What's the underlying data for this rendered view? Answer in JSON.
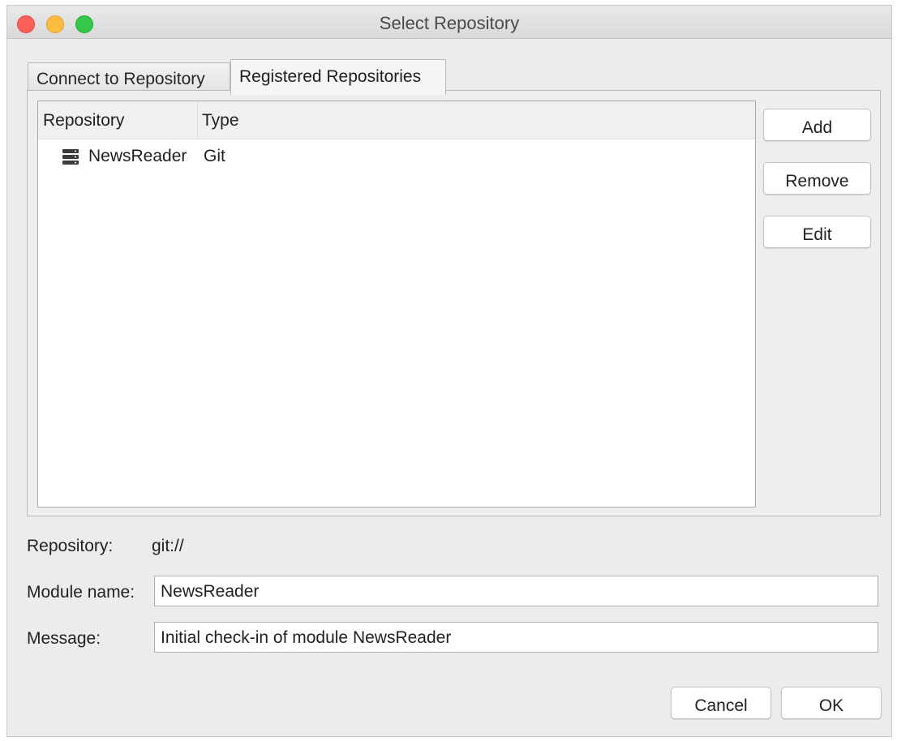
{
  "window": {
    "title": "Select Repository"
  },
  "tabs": [
    {
      "label": "Connect to Repository",
      "active": false
    },
    {
      "label": "Registered Repositories",
      "active": true
    }
  ],
  "table": {
    "columns": [
      "Repository",
      "Type"
    ],
    "rows": [
      {
        "icon": "server-icon",
        "name": "NewsReader",
        "type": "Git"
      }
    ]
  },
  "side_buttons": {
    "add": "Add",
    "remove": "Remove",
    "edit": "Edit"
  },
  "form": {
    "repository_label": "Repository:",
    "repository_value": "git://",
    "module_label": "Module name:",
    "module_value": "NewsReader",
    "message_label": "Message:",
    "message_value": "Initial check-in of module NewsReader"
  },
  "footer": {
    "cancel": "Cancel",
    "ok": "OK"
  },
  "colors": {
    "close": "#fc605b",
    "minimize": "#fdbc40",
    "zoom": "#34c84a"
  }
}
